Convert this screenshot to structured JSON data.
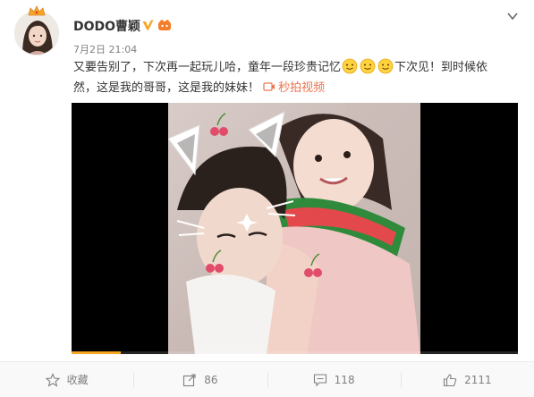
{
  "user": {
    "name": "DODO曹颖",
    "date": "7月2日",
    "time": "21:04"
  },
  "post": {
    "line1_before": "又要告别了，下次再一起玩儿哈，童年一段珍贵记忆",
    "line1_after": "下次见！到时候依",
    "line2": "然，这是我的哥哥，这是我的妹妹！",
    "video_link_label": "秒拍视频"
  },
  "video": {
    "progress_fraction": 0.11
  },
  "actions": {
    "favorite_label": "收藏",
    "repost_count": "86",
    "comment_count": "118",
    "like_count": "2111"
  },
  "icons": {
    "verify": "verified-badge-icon",
    "member": "vip-member-icon",
    "more": "chevron-down-icon",
    "smiley": "smiley-emoji-icon",
    "video": "video-icon",
    "favorite": "star-icon",
    "repost": "repost-icon",
    "comment": "comment-icon",
    "like": "thumbs-up-icon"
  },
  "colors": {
    "accent": "#eb7350",
    "verify": "#f6a623",
    "text": "#333333",
    "muted": "#808080"
  }
}
